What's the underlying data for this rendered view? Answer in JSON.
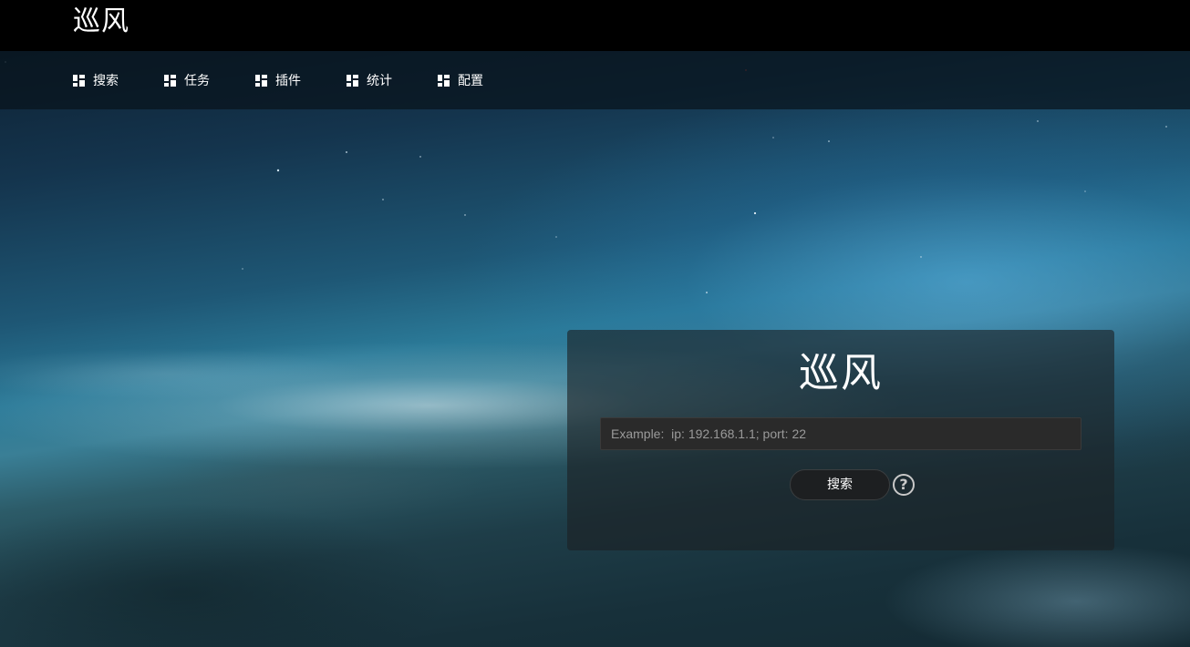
{
  "header": {
    "brand": "巡风"
  },
  "nav": {
    "items": [
      {
        "label": "搜索",
        "icon": "dashboard-icon"
      },
      {
        "label": "任务",
        "icon": "dashboard-icon"
      },
      {
        "label": "插件",
        "icon": "dashboard-icon"
      },
      {
        "label": "统计",
        "icon": "dashboard-icon"
      },
      {
        "label": "配置",
        "icon": "dashboard-icon"
      }
    ]
  },
  "search_panel": {
    "title": "巡风",
    "input_placeholder": "Example:  ip: 192.168.1.1; port: 22",
    "input_value": "",
    "button_label": "搜索",
    "help_icon": "?"
  },
  "colors": {
    "header_bg": "#000000",
    "nav_bg": "#08141c",
    "panel_bg": "#1c2024",
    "button_bg": "#1d1f21",
    "text": "#ffffff"
  }
}
